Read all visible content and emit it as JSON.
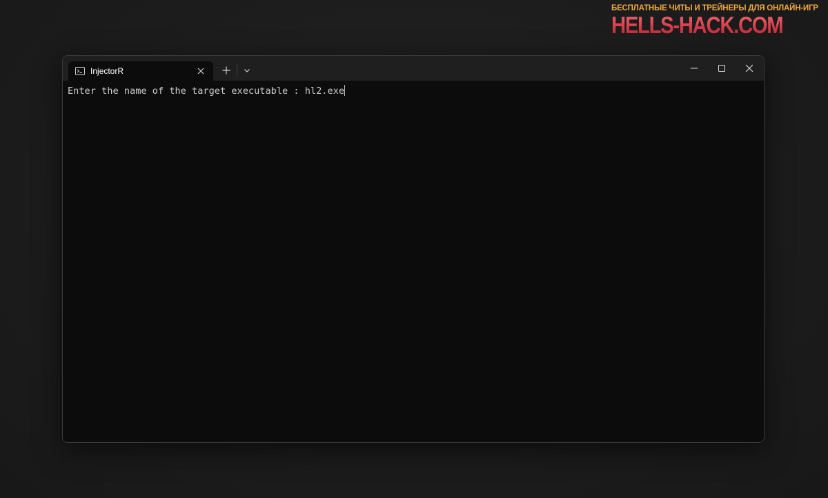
{
  "watermark": {
    "tagline": "БЕСПЛАТНЫЕ ЧИТЫ И ТРЕЙНЕРЫ ДЛЯ ОНЛАЙН-ИГР",
    "site": "HELLS-HACK.COM"
  },
  "window": {
    "tab": {
      "title": "InjectorR",
      "icon": "terminal-icon"
    },
    "controls": {
      "new_tab_icon": "plus-icon",
      "dropdown_icon": "chevron-down-icon",
      "minimize_icon": "minimize-icon",
      "maximize_icon": "maximize-icon",
      "close_icon": "close-icon"
    },
    "terminal": {
      "prompt": "Enter the name of the target executable : ",
      "input": "hl2.exe"
    }
  },
  "colors": {
    "desktop_bg": "#1c1c1c",
    "titlebar_bg": "#1f1f1f",
    "terminal_bg": "#0c0c0c",
    "terminal_text": "#cccccc",
    "watermark_tagline": "#f2a93b",
    "watermark_site": "#d94a55"
  }
}
